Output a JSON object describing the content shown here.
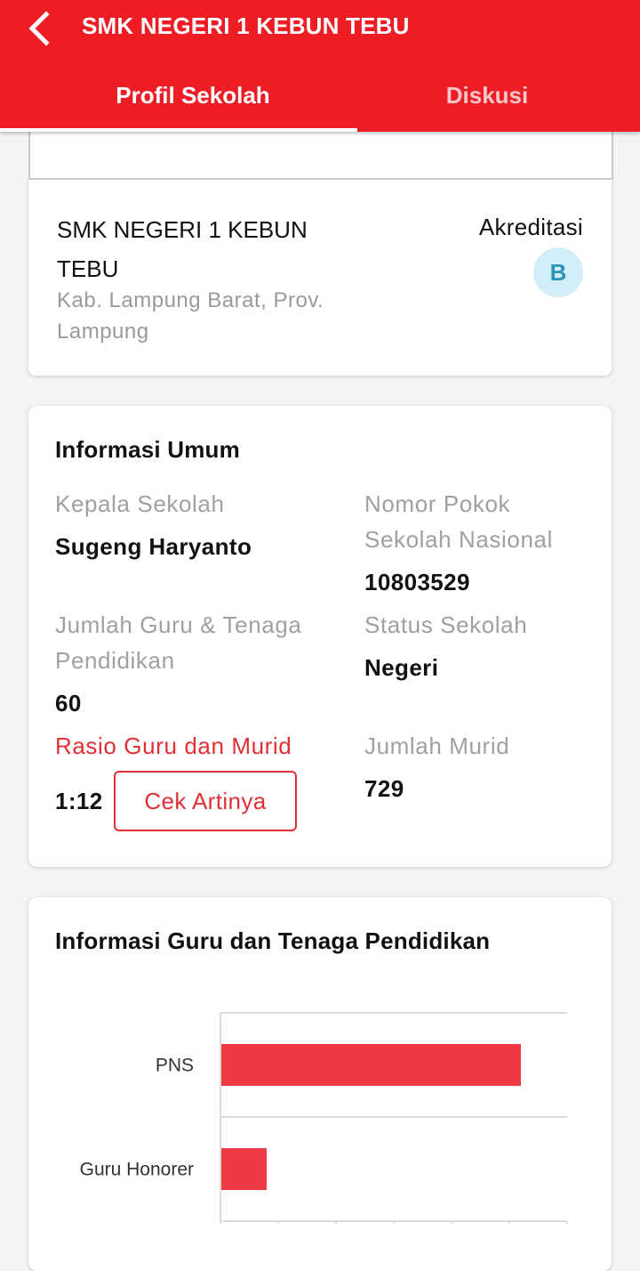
{
  "header": {
    "title": "SMK NEGERI 1 KEBUN TEBU",
    "back_icon": "chevron-left-icon",
    "tabs": [
      {
        "label": "Profil Sekolah",
        "active": true
      },
      {
        "label": "Diskusi",
        "active": false
      }
    ]
  },
  "colors": {
    "primary": "#ee1c25",
    "accent_red": "#e03035",
    "bar": "#ee3b43",
    "badge_bg": "#d4eef9",
    "badge_text": "#2a95b8"
  },
  "school": {
    "name": "SMK NEGERI 1 KEBUN TEBU",
    "location": "Kab. Lampung Barat, Prov. Lampung",
    "akreditasi_label": "Akreditasi",
    "akreditasi_value": "B"
  },
  "info_umum": {
    "title": "Informasi Umum",
    "kepala_sekolah_label": "Kepala Sekolah",
    "kepala_sekolah_value": "Sugeng Haryanto",
    "npsn_label": "Nomor Pokok Sekolah Nasional",
    "npsn_value": "10803529",
    "jumlah_guru_label": "Jumlah Guru & Tenaga Pendidikan",
    "jumlah_guru_value": "60",
    "status_label": "Status Sekolah",
    "status_value": "Negeri",
    "rasio_label": "Rasio Guru dan Murid",
    "rasio_value": "1:12",
    "cek_button": "Cek Artinya",
    "jumlah_murid_label": "Jumlah Murid",
    "jumlah_murid_value": "729"
  },
  "info_guru": {
    "title": "Informasi Guru dan Tenaga Pendidikan"
  },
  "chart_data": {
    "type": "bar",
    "orientation": "horizontal",
    "categories": [
      "PNS",
      "Guru Honorer"
    ],
    "values": [
      52,
      8
    ],
    "xlim": [
      0,
      60
    ],
    "grid": true,
    "legend": "none"
  }
}
